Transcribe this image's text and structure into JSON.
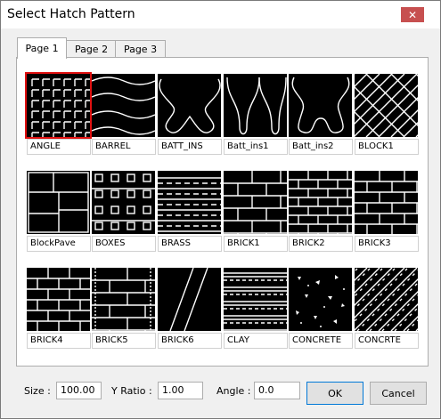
{
  "window": {
    "title": "Select Hatch Pattern",
    "close_icon": "close-icon"
  },
  "tabs": [
    {
      "label": "Page 1",
      "active": true
    },
    {
      "label": "Page 2",
      "active": false
    },
    {
      "label": "Page 3",
      "active": false
    }
  ],
  "patterns": [
    {
      "name": "ANGLE",
      "selected": true
    },
    {
      "name": "BARREL"
    },
    {
      "name": "BATT_INS"
    },
    {
      "name": "Batt_ins1"
    },
    {
      "name": "Batt_ins2"
    },
    {
      "name": "BLOCK1"
    },
    {
      "name": "BlockPave"
    },
    {
      "name": "BOXES"
    },
    {
      "name": "BRASS"
    },
    {
      "name": "BRICK1"
    },
    {
      "name": "BRICK2"
    },
    {
      "name": "BRICK3"
    },
    {
      "name": "BRICK4"
    },
    {
      "name": "BRICK5"
    },
    {
      "name": "BRICK6"
    },
    {
      "name": "CLAY"
    },
    {
      "name": "CONCRETE"
    },
    {
      "name": "CONCRTE"
    }
  ],
  "footer": {
    "size_label": "Size :",
    "size_value": "100.00",
    "yratio_label": "Y Ratio :",
    "yratio_value": "1.00",
    "angle_label": "Angle :",
    "angle_value": "0.0",
    "ok_label": "OK",
    "cancel_label": "Cancel"
  },
  "colors": {
    "selection": "#e01010",
    "title_close": "#c75050",
    "default_button_border": "#0078d7"
  }
}
